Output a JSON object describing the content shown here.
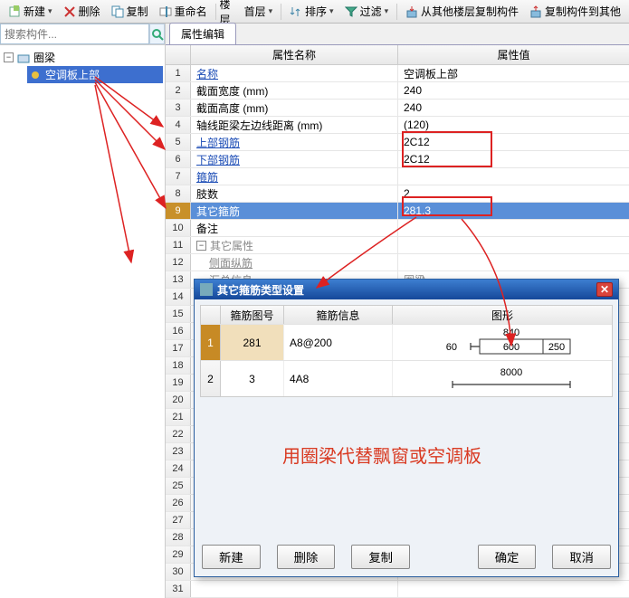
{
  "toolbar": {
    "new": "新建",
    "delete": "删除",
    "copy": "复制",
    "rename": "重命名",
    "floor_lbl": "楼层",
    "floor_sel": "首层",
    "sort": "排序",
    "filter": "过滤",
    "copy_from": "从其他楼层复制构件",
    "copy_to": "复制构件到其他"
  },
  "sidebar": {
    "search_ph": "搜索构件...",
    "root": "圈梁",
    "child": "空调板上部"
  },
  "tab": {
    "label": "属性编辑"
  },
  "grid": {
    "head_name": "属性名称",
    "head_value": "属性值",
    "rows": [
      {
        "n": "1",
        "name": "名称",
        "val": "空调板上部",
        "link": true
      },
      {
        "n": "2",
        "name": "截面宽度 (mm)",
        "val": "240"
      },
      {
        "n": "3",
        "name": "截面高度 (mm)",
        "val": "240"
      },
      {
        "n": "4",
        "name": "轴线距梁左边线距离 (mm)",
        "val": "(120)"
      },
      {
        "n": "5",
        "name": "上部钢筋",
        "val": "2C12",
        "link": true
      },
      {
        "n": "6",
        "name": "下部钢筋",
        "val": "2C12",
        "link": true
      },
      {
        "n": "7",
        "name": "箍筋",
        "val": "",
        "link": true
      },
      {
        "n": "8",
        "name": "肢数",
        "val": "2"
      },
      {
        "n": "9",
        "name": "其它箍筋",
        "val": "281,3",
        "sel": true
      },
      {
        "n": "10",
        "name": "备注",
        "val": ""
      },
      {
        "n": "11",
        "name": "其它属性",
        "val": "",
        "group": true,
        "gray": true
      },
      {
        "n": "12",
        "name": "侧面纵筋",
        "val": "",
        "indent": true,
        "link": true,
        "gray": true
      },
      {
        "n": "13",
        "name": "汇总信息",
        "val": "圈梁",
        "indent": true,
        "gray": true
      },
      {
        "n": "14"
      },
      {
        "n": "15"
      },
      {
        "n": "16"
      },
      {
        "n": "17"
      },
      {
        "n": "18"
      },
      {
        "n": "19"
      },
      {
        "n": "20"
      },
      {
        "n": "21"
      },
      {
        "n": "22"
      },
      {
        "n": "23"
      },
      {
        "n": "24"
      },
      {
        "n": "25"
      },
      {
        "n": "26"
      },
      {
        "n": "27"
      },
      {
        "n": "28"
      },
      {
        "n": "29"
      },
      {
        "n": "30"
      },
      {
        "n": "31"
      }
    ]
  },
  "dialog": {
    "title": "其它箍筋类型设置",
    "head": {
      "c1": "箍筋图号",
      "c2": "箍筋信息",
      "c3": "图形"
    },
    "rows": [
      {
        "n": "1",
        "id": "281",
        "info": "A8@200",
        "dims": {
          "top": "840",
          "l": "60",
          "m": "600",
          "r": "250"
        }
      },
      {
        "n": "2",
        "id": "3",
        "info": "4A8",
        "dims": {
          "bot": "8000"
        }
      }
    ],
    "btns": {
      "new": "新建",
      "delete": "删除",
      "copy": "复制",
      "ok": "确定",
      "cancel": "取消"
    }
  },
  "note": "用圈梁代替飘窗或空调板"
}
